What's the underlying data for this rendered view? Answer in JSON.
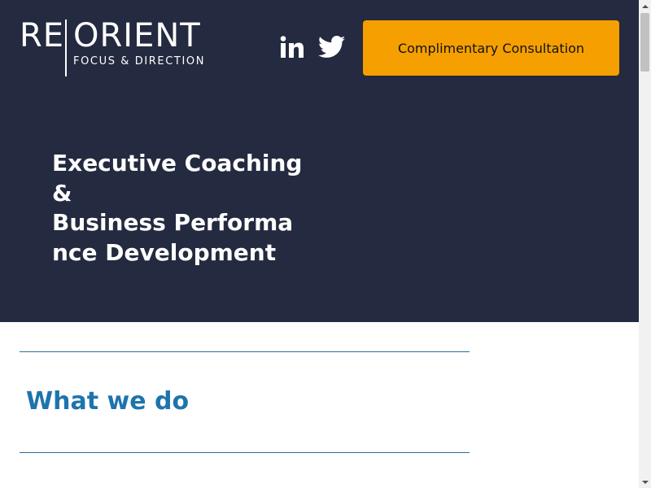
{
  "header": {
    "logo": {
      "left_text": "RE",
      "right_text": "ORIENT",
      "tagline": "FOCUS & DIRECTION"
    },
    "social": [
      {
        "name": "LinkedIn",
        "icon": "linkedin-icon"
      },
      {
        "name": "Twitter",
        "icon": "twitter-icon"
      }
    ],
    "cta_label": "Complimentary Consultation"
  },
  "hero": {
    "headline_line1": "Executive Coaching &",
    "headline_line2": "Business Performance Development"
  },
  "section": {
    "title": "What we do"
  },
  "colors": {
    "hero_background": "#242a3f",
    "cta_background": "#f5a000",
    "accent_blue": "#1e74ac",
    "rule_color": "#2a6f9a"
  }
}
